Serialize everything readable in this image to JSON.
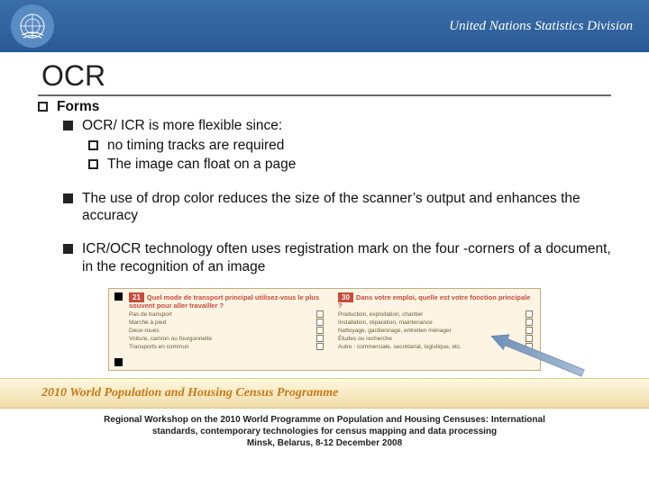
{
  "header": {
    "org": "United Nations Statistics Division"
  },
  "title": "OCR",
  "bullets": {
    "l1": "Forms",
    "l2a": "OCR/ ICR is more flexible since:",
    "l3a": "no timing tracks are required",
    "l3b": "The image can float on a page",
    "l2b": "The use of drop color reduces the size of the scanner’s output and enhances the accuracy",
    "l2c": "ICR/OCR technology often uses registration mark on the four -corners of a document, in the recognition of an image"
  },
  "form": {
    "q1num": "21",
    "q1": "Quel mode de transport principal utilisez-vous le plus souvent pour aller travailler ?",
    "q1opts": [
      "Pas de transport",
      "Marche à pied",
      "Deux-roues",
      "Voiture, camion ou fourgonnette",
      "Transports en commun"
    ],
    "q2num": "30",
    "q2": "Dans votre emploi, quelle est votre fonction principale ?",
    "q2opts": [
      "Production, exploitation, chantier",
      "Installation, réparation, maintenance",
      "Nettoyage, gardiennage, entretien ménager",
      "Études ou recherche",
      "Autre : commerciale, secrétariat, logistique, etc."
    ]
  },
  "banner": "2010 World Population and Housing Census Programme",
  "footer": {
    "line1": "Regional Workshop on the 2010 World Programme on Population and Housing Censuses: International",
    "line2": "standards, contemporary technologies for census mapping and data processing",
    "line3": "Minsk, Belarus, 8-12 December 2008"
  }
}
